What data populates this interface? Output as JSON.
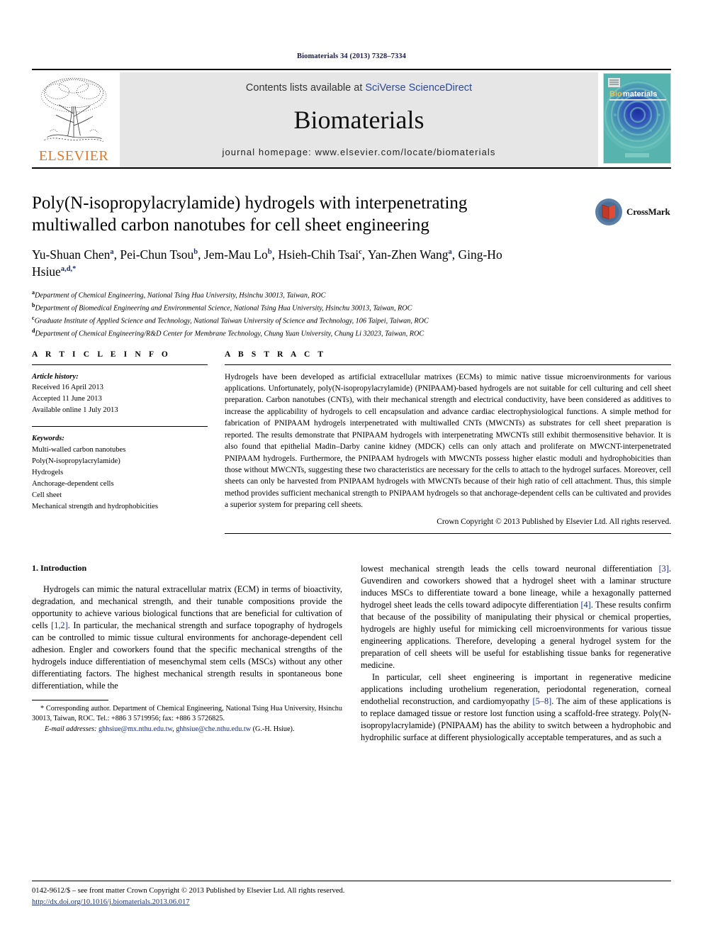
{
  "running_head": "Biomaterials 34 (2013) 7328–7334",
  "masthead": {
    "contents_prefix": "Contents lists available at ",
    "sciencedirect": "SciVerse ScienceDirect",
    "journal_name": "Biomaterials",
    "homepage": "journal homepage: www.elsevier.com/locate/biomaterials",
    "publisher_logo_text": "ELSEVIER",
    "cover_title_a": "Bio",
    "cover_title_b": "materials",
    "logo_icon": "elsevier-tree-icon",
    "cover_icon": "journal-cover-thumbnail"
  },
  "title": "Poly(N-isopropylacrylamide) hydrogels with interpenetrating multiwalled carbon nanotubes for cell sheet engineering",
  "crossmark": {
    "label": "CrossMark",
    "icon": "crossmark-icon"
  },
  "authors": [
    {
      "name": "Yu-Shuan Chen",
      "sup": "a",
      "sep": ", "
    },
    {
      "name": "Pei-Chun Tsou",
      "sup": "b",
      "sep": ", "
    },
    {
      "name": "Jem-Mau Lo",
      "sup": "b",
      "sep": ", "
    },
    {
      "name": "Hsieh-Chih Tsai",
      "sup": "c",
      "sep": ", "
    },
    {
      "name": "Yan-Zhen Wang",
      "sup": "a",
      "sep": ", "
    },
    {
      "name": "Ging-Ho Hsiue",
      "sup": "a,d,*",
      "sep": ""
    }
  ],
  "affiliations": [
    {
      "mark": "a",
      "text": "Department of Chemical Engineering, National Tsing Hua University, Hsinchu 30013, Taiwan, ROC"
    },
    {
      "mark": "b",
      "text": "Department of Biomedical Engineering and Environmental Science, National Tsing Hua University, Hsinchu 30013, Taiwan, ROC"
    },
    {
      "mark": "c",
      "text": "Graduate Institute of Applied Science and Technology, National Taiwan University of Science and Technology, 106 Taipei, Taiwan, ROC"
    },
    {
      "mark": "d",
      "text": "Department of Chemical Engineering/R&D Center for Membrane Technology, Chung Yuan University, Chung Li 32023, Taiwan, ROC"
    }
  ],
  "article_info": {
    "label": "A R T I C L E   I N F O",
    "history_label": "Article history:",
    "history": [
      "Received 16 April 2013",
      "Accepted 11 June 2013",
      "Available online 1 July 2013"
    ],
    "keywords_label": "Keywords:",
    "keywords": [
      "Multi-walled carbon nanotubes",
      "Poly(N-isopropylacrylamide)",
      "Hydrogels",
      "Anchorage-dependent cells",
      "Cell sheet",
      "Mechanical strength and hydrophobicities"
    ]
  },
  "abstract": {
    "label": "A B S T R A C T",
    "text": "Hydrogels have been developed as artificial extracellular matrixes (ECMs) to mimic native tissue microenvironments for various applications. Unfortunately, poly(N-isopropylacrylamide) (PNIPAAM)-based hydrogels are not suitable for cell culturing and cell sheet preparation. Carbon nanotubes (CNTs), with their mechanical strength and electrical conductivity, have been considered as additives to increase the applicability of hydrogels to cell encapsulation and advance cardiac electrophysiological functions. A simple method for fabrication of PNIPAAM hydrogels interpenetrated with multiwalled CNTs (MWCNTs) as substrates for cell sheet preparation is reported. The results demonstrate that PNIPAAM hydrogels with interpenetrating MWCNTs still exhibit thermosensitive behavior. It is also found that epithelial Madin–Darby canine kidney (MDCK) cells can only attach and proliferate on MWCNT-interpenetrated PNIPAAM hydrogels. Furthermore, the PNIPAAM hydrogels with MWCNTs possess higher elastic moduli and hydrophobicities than those without MWCNTs, suggesting these two characteristics are necessary for the cells to attach to the hydrogel surfaces. Moreover, cell sheets can only be harvested from PNIPAAM hydrogels with MWCNTs because of their high ratio of cell attachment. Thus, this simple method provides sufficient mechanical strength to PNIPAAM hydrogels so that anchorage-dependent cells can be cultivated and provides a superior system for preparing cell sheets.",
    "copyright": "Crown Copyright © 2013 Published by Elsevier Ltd. All rights reserved."
  },
  "introduction": {
    "heading": "1.  Introduction",
    "left_para_1_a": "Hydrogels can mimic the natural extracellular matrix (ECM) in terms of bioactivity, degradation, and mechanical strength, and their tunable compositions provide the opportunity to achieve various biological functions that are beneficial for cultivation of cells ",
    "left_ref_1": "[1,2]",
    "left_para_1_b": ". In particular, the mechanical strength and surface topography of hydrogels can be controlled to mimic tissue cultural environments for anchorage-dependent cell adhesion. Engler and coworkers found that the specific mechanical strengths of the hydrogels induce differentiation of mesenchymal stem cells (MSCs) without any other differentiating factors. The highest mechanical strength results in spontaneous bone differentiation, while the",
    "right_para_1_a": "lowest mechanical strength leads the cells toward neuronal differentiation ",
    "right_ref_3": "[3]",
    "right_para_1_b": ". Guvendiren and coworkers showed that a hydrogel sheet with a laminar structure induces MSCs to differentiate toward a bone lineage, while a hexagonally patterned hydrogel sheet leads the cells toward adipocyte differentiation ",
    "right_ref_4": "[4]",
    "right_para_1_c": ". These results confirm that because of the possibility of manipulating their physical or chemical properties, hydrogels are highly useful for mimicking cell microenvironments for various tissue engineering applications. Therefore, developing a general hydrogel system for the preparation of cell sheets will be useful for establishing tissue banks for regenerative medicine.",
    "right_para_2_a": "In particular, cell sheet engineering is important in regenerative medicine applications including urothelium regeneration, periodontal regeneration, corneal endothelial reconstruction, and cardiomyopathy ",
    "right_ref_5": "[5–8]",
    "right_para_2_b": ". The aim of these applications is to replace damaged tissue or restore lost function using a scaffold-free strategy. Poly(N-isopropylacrylamide) (PNIPAAM) has the ability to switch between a hydrophobic and hydrophilic surface at different physiologically acceptable temperatures, and as such a"
  },
  "footnote": {
    "corr_a": "* Corresponding author. Department of Chemical Engineering, National Tsing Hua University, Hsinchu 30013, Taiwan, ROC. Tel.: +886 3 5719956; fax: +886 3 5726825.",
    "email_label": "E-mail addresses:",
    "email_1": "ghhsiue@mx.nthu.edu.tw",
    "email_sep": ", ",
    "email_2": "ghhsiue@che.nthu.edu.tw",
    "email_tail": " (G.-H. Hsiue)."
  },
  "bottom": {
    "issn_line": "0142-9612/$ – see front matter Crown Copyright © 2013 Published by Elsevier Ltd. All rights reserved.",
    "doi": "http://dx.doi.org/10.1016/j.biomaterials.2013.06.017"
  },
  "colors": {
    "elsevier_orange": "#E87722",
    "link_blue": "#1a2f7a",
    "sciencedirect_blue": "#2b4a9b",
    "masthead_gray": "#e6e6e6"
  }
}
